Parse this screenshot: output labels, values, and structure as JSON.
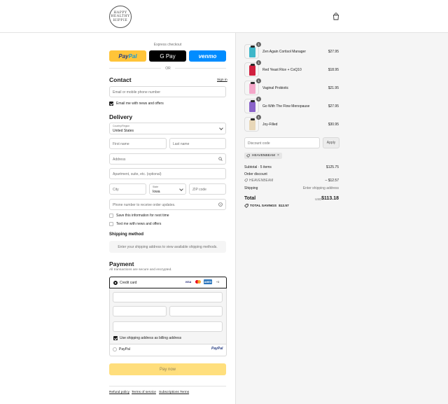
{
  "brand": {
    "logo_lines": [
      "HAPPY",
      "HEALTHY",
      "HIPPIE"
    ]
  },
  "express": {
    "label": "Express checkout",
    "paypal_pay": "Pay",
    "paypal_pal": "Pal",
    "gpay": "G Pay",
    "venmo": "venmo",
    "or": "OR"
  },
  "contact": {
    "title": "Contact",
    "sign_in": "Sign in",
    "email_placeholder": "Email or mobile phone number",
    "news_label": "Email me with news and offers"
  },
  "delivery": {
    "title": "Delivery",
    "country_label": "Country/Region",
    "country_value": "United States",
    "first_name": "First name",
    "last_name": "Last name",
    "address": "Address",
    "apartment": "Apartment, suite, etc. (optional)",
    "city": "City",
    "state_label": "State",
    "state_value": "Iowa",
    "zip": "ZIP code",
    "phone": "Phone number to receive order updates.",
    "save_info": "Save this information for next time",
    "text_me": "Text me with news and offers"
  },
  "shipping_method": {
    "title": "Shipping method",
    "message": "Enter your shipping address to view available shipping methods."
  },
  "payment": {
    "title": "Payment",
    "subtitle": "All transactions are secure and encrypted.",
    "credit_card": "Credit card",
    "cards": {
      "visa": "VISA",
      "amex": "AMEX",
      "more": "+3"
    },
    "billing_same": "Use shipping address as billing address",
    "paypal": "PayPal",
    "paypal_logo": "PayPal"
  },
  "pay_now": "Pay now",
  "footer_links": [
    "Refund policy",
    "Terms of service",
    "Subscriptions Terms"
  ],
  "cart": {
    "items": [
      {
        "name": "Zen Again Cortisol Manager",
        "price": "$27.95",
        "qty": "1",
        "color": "#3fb7c9"
      },
      {
        "name": "Red Yeast Rice + CoQ10",
        "price": "$18.95",
        "qty": "1",
        "color": "#d1203f"
      },
      {
        "name": "Vaginal Probiotic",
        "price": "$21.95",
        "qty": "1",
        "color": "#f4a7c9"
      },
      {
        "name": "Go With The Flow Menopause",
        "price": "$27.95",
        "qty": "1",
        "color": "#8a63c9"
      },
      {
        "name": "Joy-Filled",
        "price": "$30.95",
        "qty": "1",
        "color": "#e8d7b8"
      }
    ],
    "discount_placeholder": "Discount code",
    "apply": "Apply",
    "applied_code": "HEAVENBEAM",
    "remove": "×",
    "subtotal_label": "Subtotal · 5 items",
    "subtotal_value": "$125.75",
    "order_discount_label": "Order discount",
    "discount_code": "HEAVENBEAM",
    "discount_value": "– $12.57",
    "shipping_label": "Shipping",
    "shipping_value": "Enter shipping address",
    "total_label": "Total",
    "currency": "USD",
    "total_value": "$113.18",
    "savings_label": "TOTAL SAVINGS",
    "savings_value": "$12.57"
  }
}
